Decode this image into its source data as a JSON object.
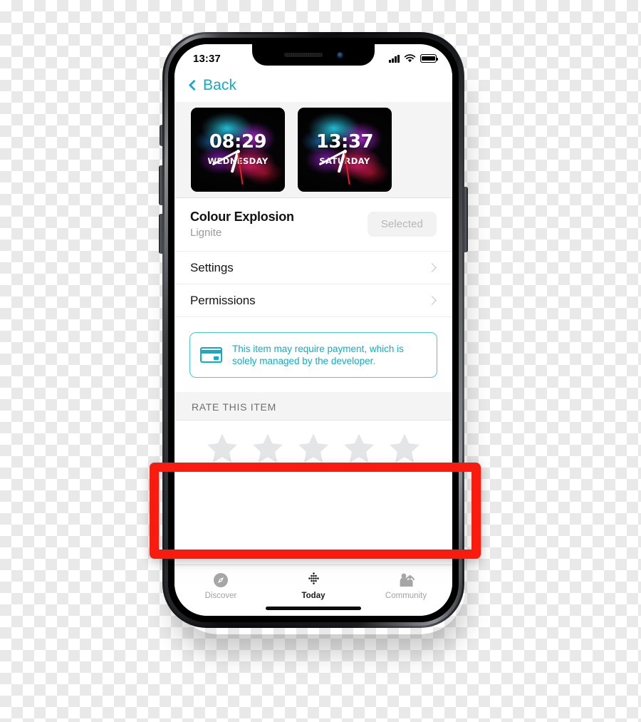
{
  "status_bar": {
    "time": "13:37",
    "signal_icon": "cellular-signal-icon",
    "wifi_icon": "wifi-icon",
    "battery_icon": "battery-full-icon"
  },
  "nav": {
    "back_label": "Back",
    "back_icon": "chevron-left-icon"
  },
  "carousel": {
    "faces": [
      {
        "time": "08:29",
        "day": "WEDNESDAY"
      },
      {
        "time": "13:37",
        "day": "SATURDAY"
      }
    ]
  },
  "detail": {
    "title": "Colour Explosion",
    "author": "Lignite",
    "selected_label": "Selected"
  },
  "rows": [
    {
      "label": "Settings",
      "chevron_icon": "chevron-right-icon"
    },
    {
      "label": "Permissions",
      "chevron_icon": "chevron-right-icon"
    }
  ],
  "payment_notice": {
    "icon": "credit-card-icon",
    "text": "This item may require payment, which is solely managed by the developer."
  },
  "rate": {
    "header": "RATE THIS ITEM",
    "stars_total": 5,
    "stars_filled": 0,
    "star_icon": "star-icon"
  },
  "tabs": [
    {
      "label": "Discover",
      "icon": "compass-icon",
      "active": false
    },
    {
      "label": "Today",
      "icon": "today-dots-icon",
      "active": true
    },
    {
      "label": "Community",
      "icon": "people-icon",
      "active": false
    }
  ],
  "colors": {
    "accent_teal": "#12ACC4",
    "highlight_red": "#F91B0E",
    "star_gray": "#E3E5E6",
    "panel_gray": "#F4F4F4"
  }
}
